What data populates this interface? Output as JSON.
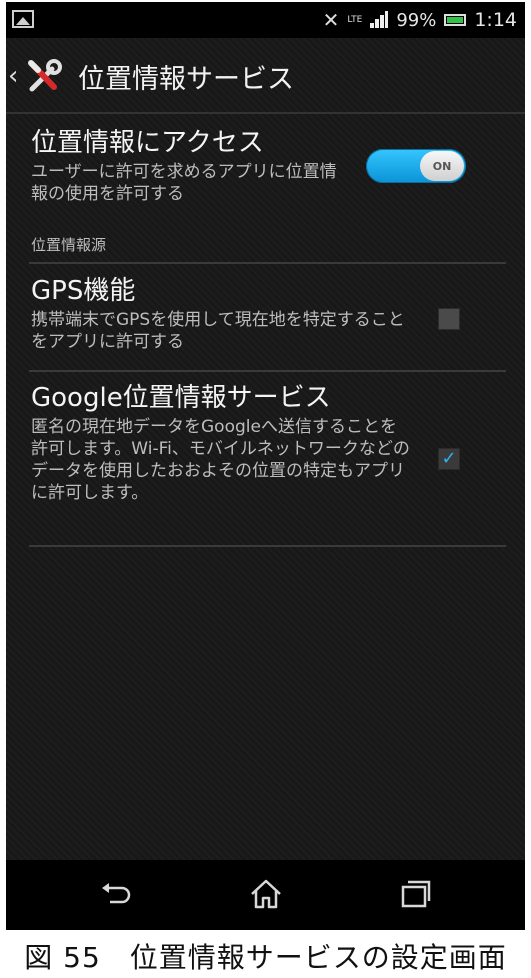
{
  "status_bar": {
    "battery": "99%",
    "time": "1:14",
    "network": "LTE",
    "icons": [
      "gallery-icon",
      "no-signal-icon",
      "signal-icon",
      "battery-icon"
    ]
  },
  "action_bar": {
    "title": "位置情報サービス",
    "icon": "tools-icon"
  },
  "settings": {
    "access": {
      "title": "位置情報にアクセス",
      "description": "ユーザーに許可を求めるアプリに位置情報の使用を許可する",
      "toggle_label": "ON",
      "toggle_on": true
    },
    "category_label": "位置情報源",
    "gps": {
      "title": "GPS機能",
      "description": "携帯端末でGPSを使用して現在地を特定することをアプリに許可する",
      "checked": false
    },
    "google": {
      "title": "Google位置情報サービス",
      "description": "匿名の現在地データをGoogleへ送信することを許可します。Wi-Fi、モバイルネットワークなどのデータを使用したおおよその位置の特定もアプリに許可します。",
      "checked": true
    }
  },
  "nav_bar": {
    "icons": [
      "back-icon",
      "home-icon",
      "recent-apps-icon"
    ]
  },
  "caption": "図 55　位置情報サービスの設定画面",
  "colors": {
    "accent": "#1ba5e8",
    "background": "#181818"
  }
}
